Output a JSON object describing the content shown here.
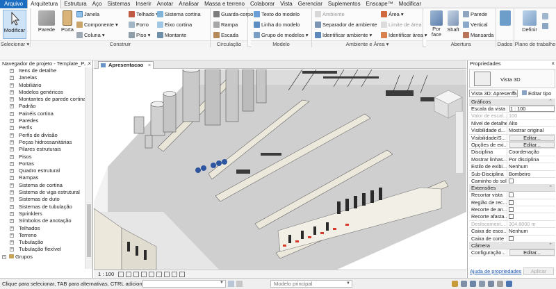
{
  "menu": {
    "tabs": [
      "Arquivo",
      "Arquitetura",
      "Estrutura",
      "Aço",
      "Sistemas",
      "Inserir",
      "Anotar",
      "Analisar",
      "Massa e terreno",
      "Colaborar",
      "Vista",
      "Gerenciar",
      "Suplementos",
      "Enscape™",
      "Modificar"
    ]
  },
  "ribbon": {
    "selecionar": {
      "modify_label": "Modificar",
      "title": "Selecionar ▾"
    },
    "construir": {
      "title": "Construir",
      "parede": "Parede",
      "porta": "Porta",
      "janela": "Janela",
      "componente": "Componente ▾",
      "coluna": "Coluna ▾",
      "telhado": "Telhado ▾",
      "forro": "Forro",
      "piso": "Piso ▾",
      "sistema_cortina": "Sistema cortina",
      "eixo_cortina": "Eixo cortina",
      "montante": "Montante"
    },
    "circulacao": {
      "title": "Circulação",
      "guarda_corpo": "Guarda-corpo ▾",
      "rampa": "Rampa",
      "escada": "Escada"
    },
    "modelo": {
      "title": "Modelo",
      "texto": "Texto do modelo",
      "linha": "Linha do modelo",
      "grupo": "Grupo de modelos ▾"
    },
    "ambiente": {
      "title": "Ambiente e Área ▾",
      "ambiente": "Ambiente",
      "separador": "Separador de ambiente",
      "identificar_ambiente": "Identificar ambiente ▾",
      "area": "Área ▾",
      "limite": "Limite de área",
      "identificar_area": "Identificar área ▾"
    },
    "abertura": {
      "title": "Abertura",
      "por_face": "Por face",
      "shaft": "Shaft",
      "parede": "Parede",
      "vertical": "Vertical",
      "mansarda": "Mansarda"
    },
    "dados": {
      "title": "Dados"
    },
    "plano": {
      "title": "Plano de trabalho",
      "definir": "Definir"
    }
  },
  "browser": {
    "title": "Navegador de projeto - Template_P...",
    "items": [
      "Itens de detalhe",
      "Janelas",
      "Mobiliário",
      "Modelos genéricos",
      "Montantes de parede cortina",
      "Padrão",
      "Painéis cortina",
      "Paredes",
      "Perfis",
      "Perfis de divisão",
      "Peças hidrossanitárias",
      "Pilares estruturais",
      "Pisos",
      "Portas",
      "Quadro estrutural",
      "Rampas",
      "Sistema de cortina",
      "Sistema de viga estrutural",
      "Sistemas de duto",
      "Sistemas de tubulação",
      "Sprinklers",
      "Símbolos de anotação",
      "Telhados",
      "Terreno",
      "Tubulação",
      "Tubulação flexível"
    ],
    "root": "Grupos"
  },
  "view": {
    "tab": "Apresentacao",
    "scale": "1 : 100"
  },
  "properties": {
    "title": "Propriedades",
    "type": "Vista 3D",
    "selector": "Vista 3D: Apresenta",
    "edit_type": "Editar tipo",
    "sections": {
      "graficos": "Gráficos",
      "extensoes": "Extensões",
      "camera": "Câmera"
    },
    "rows": [
      {
        "k": "Escala da vista",
        "v": "1 : 100"
      },
      {
        "k": "Valor de escal...",
        "v": "100"
      },
      {
        "k": "Nível de detalhe",
        "v": "Alto"
      },
      {
        "k": "Visibilidade d...",
        "v": "Mostrar original"
      },
      {
        "k": "Visibilidade/S...",
        "v": "Editar..."
      },
      {
        "k": "Opções de exi...",
        "v": "Editar..."
      },
      {
        "k": "Disciplina",
        "v": "Coordenação"
      },
      {
        "k": "Mostrar linhas...",
        "v": "Por disciplina"
      },
      {
        "k": "Estilo de exibi...",
        "v": "Nenhum"
      },
      {
        "k": "Sub-Disciplina",
        "v": "Bombeiro"
      },
      {
        "k": "Caminho do sol",
        "v": ""
      }
    ],
    "ext_rows": [
      {
        "k": "Recortar vista",
        "v": ""
      },
      {
        "k": "Região de rec...",
        "v": ""
      },
      {
        "k": "Recorte de an...",
        "v": ""
      },
      {
        "k": "Recorte afasta...",
        "v": ""
      },
      {
        "k": "Deslocament...",
        "v": "304.8000 m"
      },
      {
        "k": "Caixa de esco...",
        "v": "Nenhum"
      },
      {
        "k": "Caixa de corte",
        "v": ""
      }
    ],
    "camera_rows": [
      {
        "k": "Configuração...",
        "v": "Editar..."
      }
    ],
    "help": "Ajuda de propriedades",
    "apply": "Aplicar"
  },
  "status": {
    "message": "Clique para selecionar, TAB para alternativas, CTRL adiciona,",
    "model": "Modelo principal"
  }
}
